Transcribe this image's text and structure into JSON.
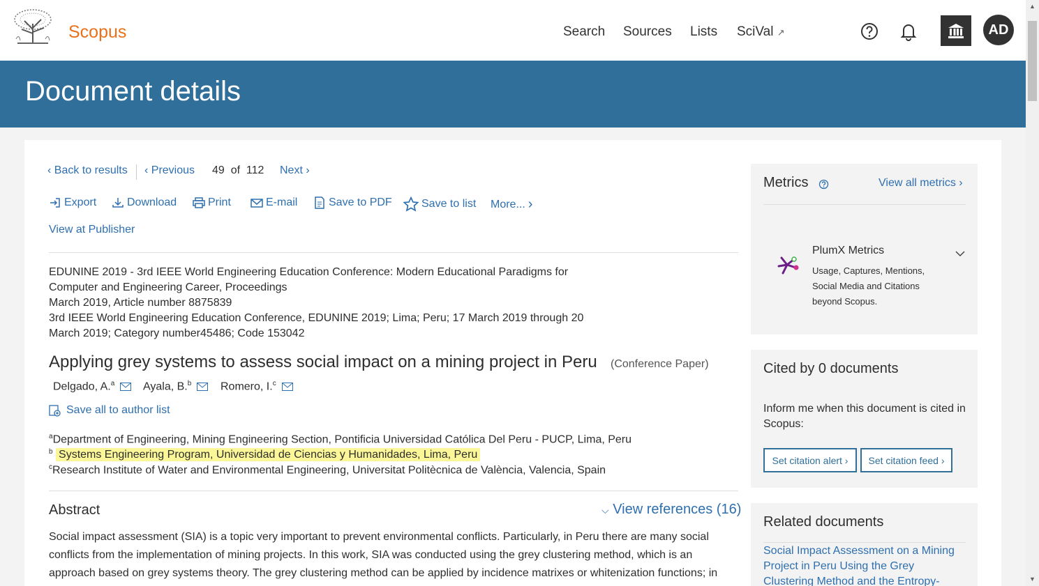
{
  "header": {
    "brand": "Scopus",
    "nav": [
      "Search",
      "Sources",
      "Lists",
      "SciVal"
    ],
    "nav_external": "↗",
    "avatar_initials": "AD"
  },
  "banner": {
    "title": "Document details"
  },
  "toolbar": {
    "back": "Back to results",
    "previous": "Previous",
    "position": "49",
    "of": "of",
    "total": "112",
    "next": "Next",
    "actions": [
      "Export",
      "Download",
      "Print",
      "E-mail",
      "Save to PDF",
      "Save to list",
      "More..."
    ],
    "view_publisher": "View at Publisher"
  },
  "source": {
    "lines": [
      "EDUNINE 2019 - 3rd IEEE World Engineering Education Conference: Modern Educational Paradigms for",
      "Computer and Engineering Career, Proceedings",
      "March 2019, Article number 8875839",
      "3rd IEEE World Engineering Education Conference, EDUNINE 2019; Lima; Peru; 17 March 2019 through 20",
      "March 2019; Category number45486; Code 153042"
    ]
  },
  "document": {
    "title": "Applying grey systems to assess social impact on a mining project in Peru",
    "type": "(Conference Paper)",
    "authors": [
      {
        "name": "Delgado, A.",
        "aff": "a"
      },
      {
        "name": "Ayala, B.",
        "aff": "b"
      },
      {
        "name": "Romero, I.",
        "aff": "c"
      }
    ],
    "save_authors": "Save all to author list",
    "affiliations": [
      {
        "key": "a",
        "text": "Department of Engineering, Mining Engineering Section, Pontificia Universidad Católica Del Peru - PUCP, Lima, Peru"
      },
      {
        "key": "b",
        "text": "Systems Engineering Program, Universidad de Ciencias y Humanidades, Lima, Peru"
      },
      {
        "key": "c",
        "text": "Research Institute of Water and Environmental Engineering, Universitat Politècnica de València, Valencia, Spain"
      }
    ],
    "abstract_heading": "Abstract",
    "view_references": "View references (16)",
    "abstract_lines": [
      "Social impact assessment (SIA) is a topic very important to prevent environmental conflicts. Particularly, in Peru there are many social",
      "conflicts from the implementation of mining projects. In this work, SIA was conducted using the grey clustering method, which is an",
      "approach based on grey systems theory. The grey clustering method can be applied by incidence matrixes or whitenization functions; in"
    ]
  },
  "metrics": {
    "heading": "Metrics",
    "view_all": "View all metrics",
    "plumx_title": "PlumX Metrics",
    "plumx_desc": "Usage, Captures, Mentions, Social Media and Citations beyond Scopus."
  },
  "cited": {
    "heading": "Cited by 0 documents",
    "inform": "Inform me when this document is cited in Scopus:",
    "alert_btn": "Set citation alert",
    "feed_btn": "Set citation feed"
  },
  "related": {
    "heading": "Related documents",
    "first_link": "Social Impact Assessment on a Mining Project in Peru Using the Grey Clustering Method and the Entropy-"
  },
  "colors": {
    "brand": "#e9711c",
    "banner": "#2f6f9a",
    "link": "#2e6fb0",
    "highlight": "#fbf698"
  }
}
